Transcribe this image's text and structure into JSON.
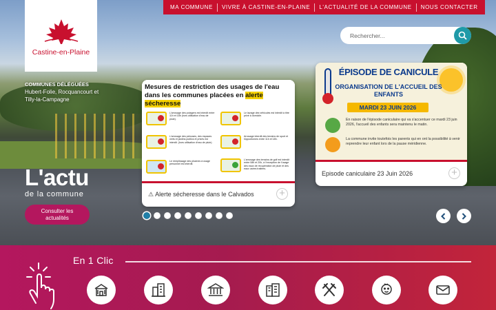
{
  "logo": {
    "name": "Castine-en-Plaine"
  },
  "communes": {
    "title": "COMMUNES DÉLÉGUÉES",
    "list": "Hubert-Folie, Rocquancourt et Tilly-la-Campagne"
  },
  "nav": {
    "items": [
      "MA COMMUNE",
      "VIVRE À CASTINE-EN-PLAINE",
      "L'ACTUALITÉ DE LA COMMUNE",
      "NOUS CONTACTER"
    ]
  },
  "search": {
    "placeholder": "Rechercher..."
  },
  "hero": {
    "title": "L'actu",
    "subtitle": "de la commune",
    "button_label": "Consulter les actualités"
  },
  "cards": [
    {
      "caption": "⚠ Alerte sécheresse dans le Calvados",
      "poster": {
        "title_pre": "Mesures de restriction des usages de l'eau dans les communes placées en ",
        "title_hl": "alerte sécheresse",
        "rows": [
          "L'arrosage des potagers est interdit entre 11h et 18h (hors utilisation d'eau de pluie).",
          "Le lavage des véhicules est interdit à titre privé à domicile.",
          "L'arrosage des pelouses, des espaces verts et jardins publics et privés est interdit. (hors utilisation d'eau de pluie).",
          "Arrosage interdit des terrains de sport et hippodromes entre 11h et 18h.",
          "Le remplissage des piscines à usage personnel est interdit.",
          "L'arrosage des terrains de golf est interdit entre 08h et 20h, à l'exception de l'usage des eaux de récupération de pluie et des eaux usées traitées."
        ]
      }
    },
    {
      "caption": "Episode caniculaire 23 Juin 2026",
      "poster": {
        "heading": "ÉPISODE DE CANICULE",
        "sub": "ORGANISATION DE L'ACCUEIL DES ENFANTS",
        "date": "MARDI 23 JUIN 2026",
        "body1": "En raison de l'épisode caniculaire qui va s'accentuer ce mardi 23 juin 2026, l'accueil des enfants sera maintenu le matin.",
        "body2": "La commune invite toutefois les parents qui en ont la possibilité à venir reprendre leur enfant lors de la pause méridienne."
      }
    }
  ],
  "carousel": {
    "count": 9,
    "active_index": 0
  },
  "quick": {
    "title": "En 1 Clic",
    "items": [
      {
        "icon": "town-hall-icon"
      },
      {
        "icon": "buildings-icon"
      },
      {
        "icon": "monument-icon"
      },
      {
        "icon": "apartment-icon"
      },
      {
        "icon": "restaurant-icon"
      },
      {
        "icon": "child-icon"
      },
      {
        "icon": "mail-icon"
      }
    ]
  },
  "colors": {
    "brand_red": "#c8102e",
    "magenta": "#b4175e",
    "teal": "#1f9aa8"
  }
}
